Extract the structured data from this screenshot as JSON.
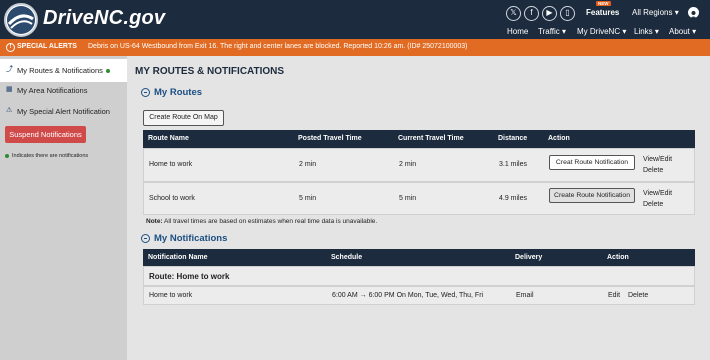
{
  "header": {
    "site_name": "DriveNC.gov",
    "social_icons": [
      "x-icon",
      "facebook-icon",
      "youtube-icon",
      "mobile-app-icon"
    ],
    "features_label": "Features",
    "new_badge": "NEW",
    "regions_label": "All Regions",
    "nav": [
      "Home",
      "Traffic",
      "My DriveNC",
      "Links",
      "About"
    ]
  },
  "alerts": {
    "label": "SPECIAL ALERTS",
    "text": "Debris on US-64 Westbound from Exit 16. The right and center lanes are blocked. Reported 10:26 am. (ID# 25072100003)"
  },
  "sidebar": {
    "items": [
      {
        "label": "My Routes & Notifications",
        "icon": "route-icon"
      },
      {
        "label": "My Area Notifications",
        "icon": "map-icon"
      },
      {
        "label": "My Special Alert Notification",
        "icon": "warning-icon"
      }
    ],
    "suspend_label": "Suspend Notifications",
    "legend_note": "Indicates there are notifications"
  },
  "main": {
    "page_title": "MY ROUTES & NOTIFICATIONS",
    "routes_heading": "My Routes",
    "create_route_map": "Create Route On Map",
    "routes_columns": [
      "Route Name",
      "Posted Travel Time",
      "Current Travel Time",
      "Distance",
      "Action"
    ],
    "routes": [
      {
        "name": "Home to work",
        "posted": "2 min",
        "current": "2 min",
        "distance": "3.1 miles",
        "action_btn": "Creat Route Notification",
        "view": "View/Edit",
        "delete": "Delete"
      },
      {
        "name": "School to work",
        "posted": "5 min",
        "current": "5 min",
        "distance": "4.9 miles",
        "action_btn": "Create Route Notification",
        "view": "View/Edit",
        "delete": "Delete"
      }
    ],
    "note_bold": "Note:",
    "note_text": " All travel times are based on estimates when real time data is unavailable.",
    "notifications_heading": "My Notifications",
    "notif_columns": [
      "Notification Name",
      "Schedule",
      "Delivery",
      "Action"
    ],
    "notif_group": "Route: Home to work",
    "notifications": [
      {
        "name": "Home to work",
        "schedule": "6:00 AM → 6:00 PM On Mon, Tue, Wed, Thu, Fri",
        "delivery": "Email",
        "edit": "Edit",
        "delete": "Delete"
      }
    ]
  }
}
